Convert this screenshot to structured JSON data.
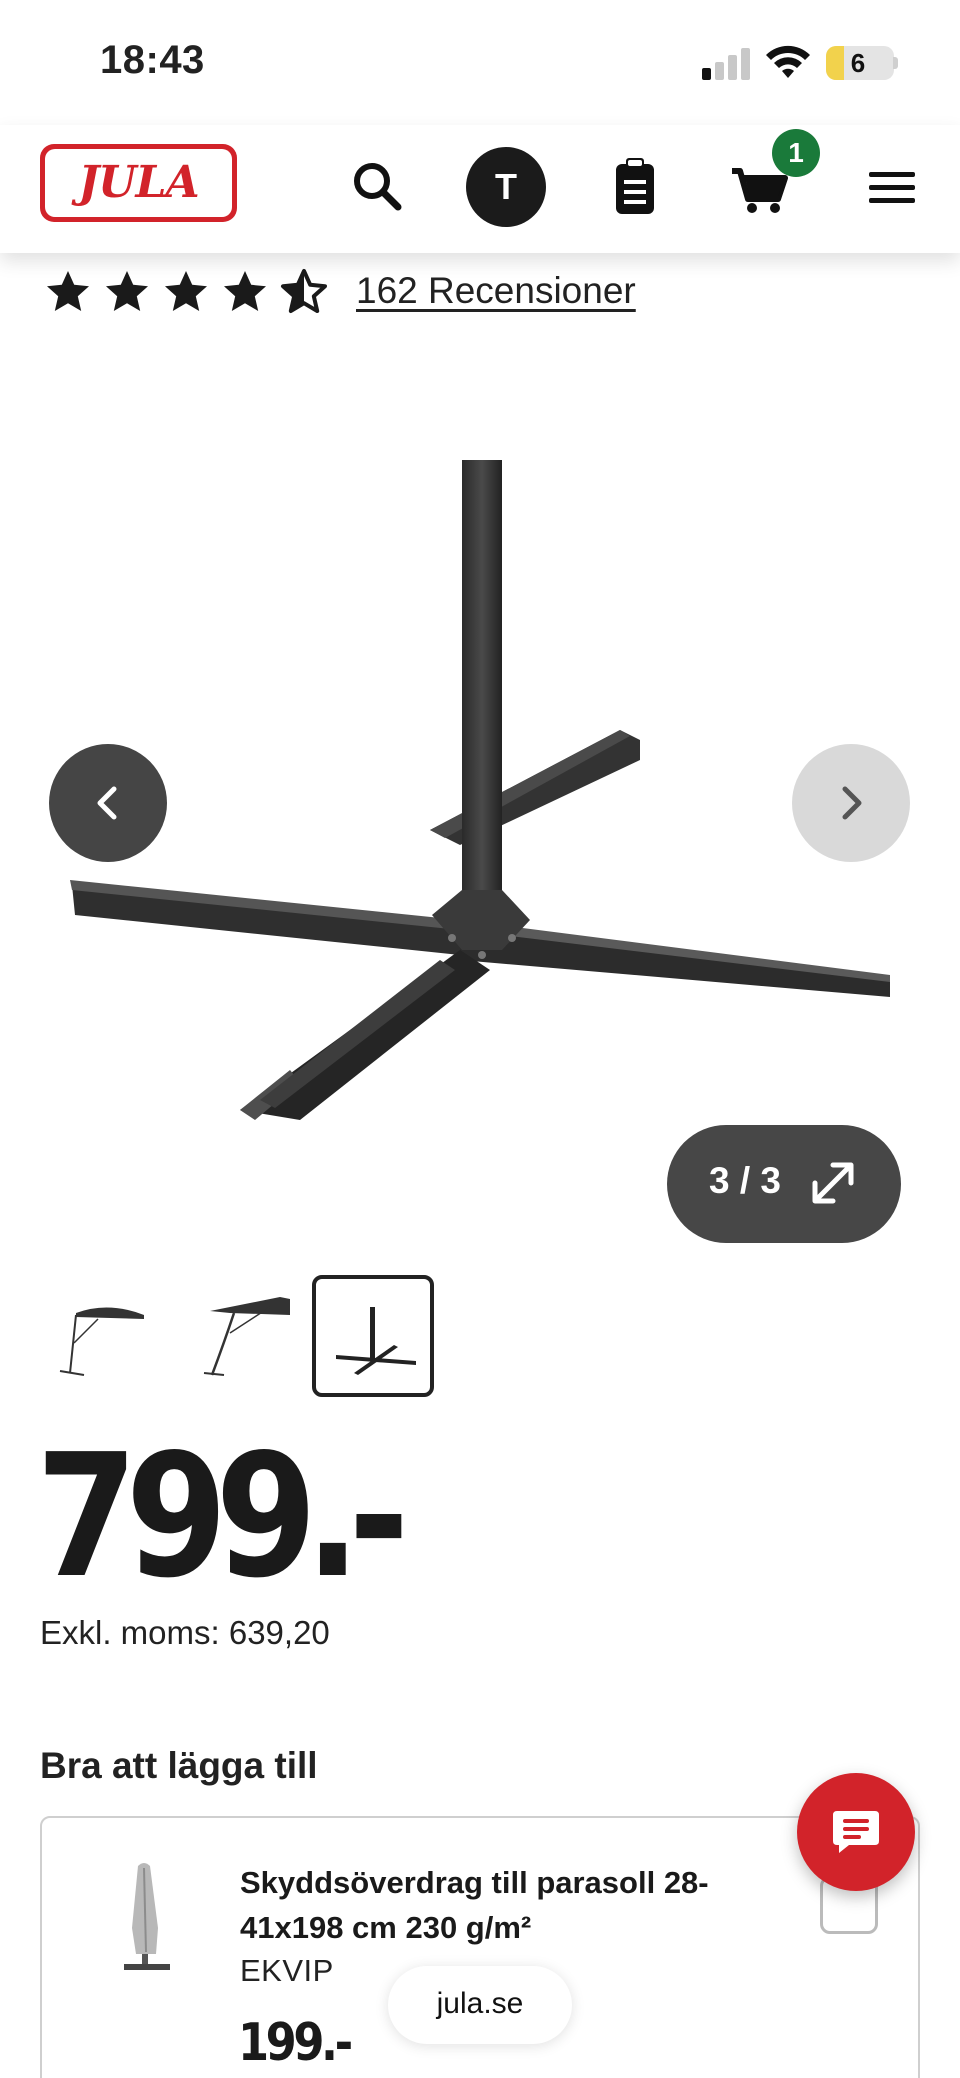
{
  "status_bar": {
    "time": "18:43",
    "battery_level": "6",
    "signal_bars_active": 1,
    "signal_bars_total": 4
  },
  "header": {
    "logo_text": "JULA",
    "avatar_initial": "T",
    "cart_count": "1",
    "icons": [
      "search-icon",
      "clipboard-icon",
      "cart-icon",
      "menu-icon"
    ]
  },
  "rating": {
    "stars": 4.5,
    "max_stars": 5,
    "reviews_label": "162 Recensioner"
  },
  "gallery": {
    "counter": "3 / 3",
    "current_index": 3,
    "total_images": 3
  },
  "product": {
    "price": "799.-",
    "excl_vat": "Exkl. moms: 639,20"
  },
  "addons": {
    "title": "Bra att lägga till",
    "items": [
      {
        "name": "Skyddsöverdrag till parasoll 28-41x198 cm 230 g/m²",
        "brand": "EKVIP",
        "price": "199.-"
      }
    ]
  },
  "browser": {
    "url": "jula.se"
  },
  "colors": {
    "brand_red": "#d2232a",
    "badge_green": "#1a7a3a"
  }
}
